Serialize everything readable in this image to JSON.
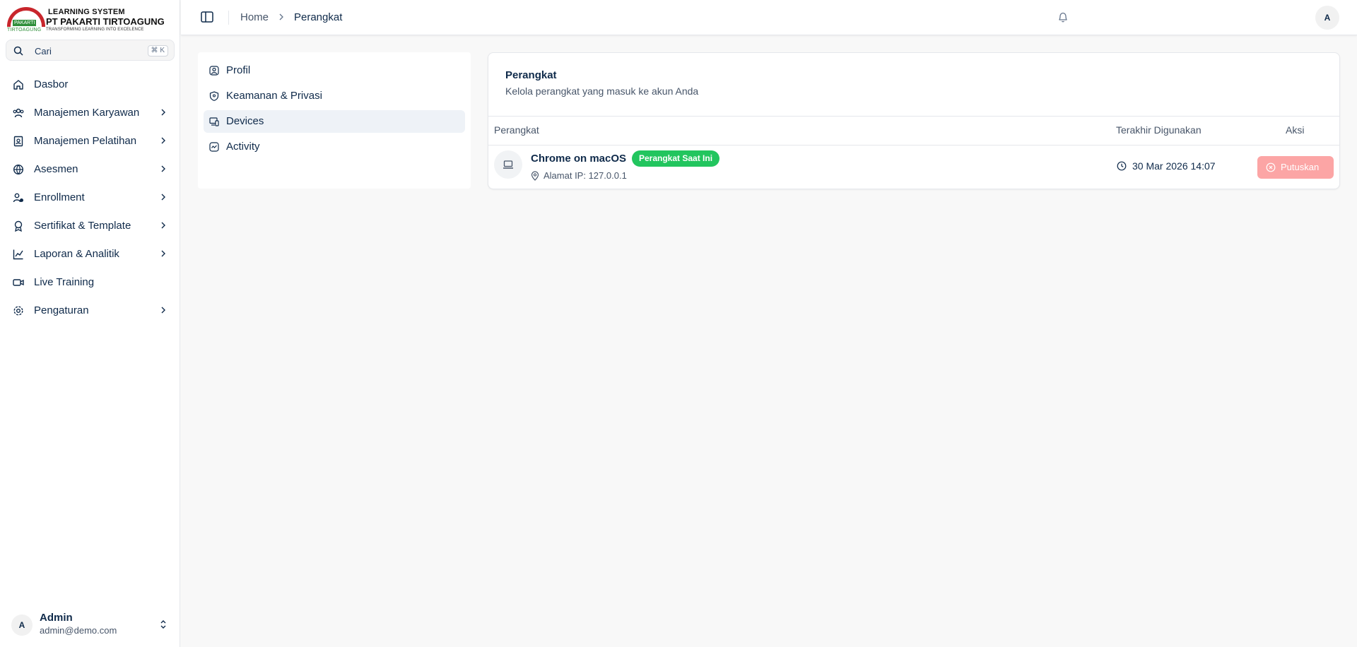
{
  "logo": {
    "line1": "LEARNING SYSTEM",
    "line2": "PT PAKARTI TIRTOAGUNG",
    "line3": "TRANSFORMING LEARNING INTO EXCELENCE",
    "tag": "PAKARTI",
    "sub": "TIRTOAGUNG"
  },
  "search": {
    "placeholder": "Cari",
    "shortcut": "⌘ K"
  },
  "sidebar": {
    "items": [
      {
        "label": "Dasbor",
        "icon": "home-icon",
        "chevron": false
      },
      {
        "label": "Manajemen Karyawan",
        "icon": "users-icon",
        "chevron": true
      },
      {
        "label": "Manajemen Pelatihan",
        "icon": "book-icon",
        "chevron": true
      },
      {
        "label": "Asesmen",
        "icon": "globe-icon",
        "chevron": true
      },
      {
        "label": "Enrollment",
        "icon": "user-plus-icon",
        "chevron": true
      },
      {
        "label": "Sertifikat & Template",
        "icon": "award-icon",
        "chevron": true
      },
      {
        "label": "Laporan & Analitik",
        "icon": "chart-icon",
        "chevron": true
      },
      {
        "label": "Live Training",
        "icon": "video-icon",
        "chevron": false
      },
      {
        "label": "Pengaturan",
        "icon": "gear-icon",
        "chevron": true
      }
    ]
  },
  "user": {
    "initial": "A",
    "name": "Admin",
    "email": "admin@demo.com"
  },
  "header": {
    "breadcrumb_home": "Home",
    "breadcrumb_current": "Perangkat",
    "avatar_initial": "A"
  },
  "settings_nav": {
    "items": [
      {
        "label": "Profil",
        "icon": "user-circle-icon",
        "active": false
      },
      {
        "label": "Keamanan & Privasi",
        "icon": "shield-icon",
        "active": false
      },
      {
        "label": "Devices",
        "icon": "devices-icon",
        "active": true
      },
      {
        "label": "Activity",
        "icon": "activity-icon",
        "active": false
      }
    ]
  },
  "devices": {
    "title": "Perangkat",
    "description": "Kelola perangkat yang masuk ke akun Anda",
    "columns": {
      "device": "Perangkat",
      "last_used": "Terakhir Digunakan",
      "action": "Aksi"
    },
    "rows": [
      {
        "name": "Chrome on macOS",
        "badge": "Perangkat Saat Ini",
        "ip": "Alamat IP: 127.0.0.1",
        "last_used": "30 Mar 2026 14:07",
        "action": "Putuskan"
      }
    ]
  },
  "colors": {
    "accent": "#0f2a4a",
    "badge": "#22c55e",
    "danger_button": "#fca5a5",
    "active_nav": "#eef2f7"
  }
}
